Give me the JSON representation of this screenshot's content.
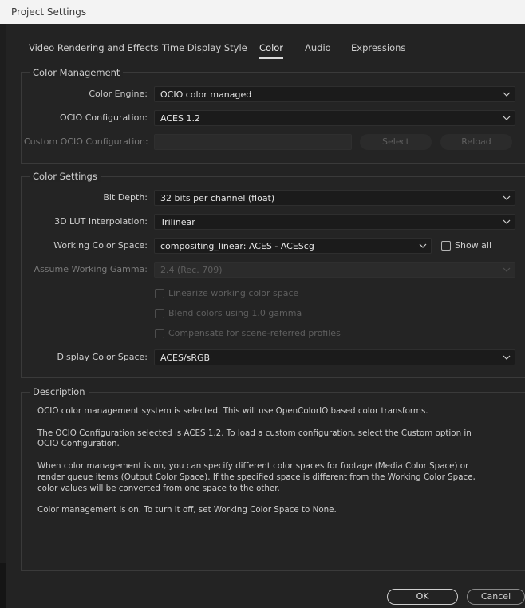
{
  "window": {
    "title": "Project Settings"
  },
  "tabs": [
    {
      "label": "Video Rendering and Effects"
    },
    {
      "label": "Time Display Style"
    },
    {
      "label": "Color",
      "active": true
    },
    {
      "label": "Audio"
    },
    {
      "label": "Expressions"
    }
  ],
  "color_management": {
    "title": "Color Management",
    "color_engine": {
      "label": "Color Engine:",
      "value": "OCIO color managed"
    },
    "ocio_configuration": {
      "label": "OCIO Configuration:",
      "value": "ACES 1.2"
    },
    "custom_ocio_configuration": {
      "label": "Custom OCIO Configuration:",
      "value": ""
    },
    "select_button": "Select",
    "reload_button": "Reload"
  },
  "color_settings": {
    "title": "Color Settings",
    "bit_depth": {
      "label": "Bit Depth:",
      "value": "32 bits per channel (float)"
    },
    "lut_interpolation": {
      "label": "3D LUT Interpolation:",
      "value": "Trilinear"
    },
    "working_color_space": {
      "label": "Working Color Space:",
      "value": "compositing_linear: ACES - ACEScg"
    },
    "show_all": {
      "label": "Show all",
      "checked": false
    },
    "assume_working_gamma": {
      "label": "Assume Working Gamma:",
      "value": "2.4 (Rec. 709)"
    },
    "linearize": {
      "label": "Linearize working color space",
      "checked": false
    },
    "blend_colors": {
      "label": "Blend colors using 1.0 gamma",
      "checked": false
    },
    "compensate": {
      "label": "Compensate for scene-referred profiles",
      "checked": false
    },
    "display_color_space": {
      "label": "Display Color Space:",
      "value": "ACES/sRGB"
    }
  },
  "description": {
    "title": "Description",
    "p1": "OCIO color management system is selected. This will use OpenColorIO based color transforms.",
    "p2a": "The OCIO Configuration selected is ACES 1.2. To load a custom configuration, select the Custom option in",
    "p2b": "OCIO Configuration.",
    "p3a": "When color management is on, you can specify different color spaces for footage (Media Color Space) or",
    "p3b": "render queue items (Output Color Space). If the specified space is different from the Working Color Space,",
    "p3c": "color values will be converted from one space to the other.",
    "p4": "Color management is on. To turn it off, set Working Color Space to None."
  },
  "footer": {
    "ok": "OK",
    "cancel": "Cancel"
  },
  "icons": {
    "dropdown": "chevron-down-icon"
  }
}
